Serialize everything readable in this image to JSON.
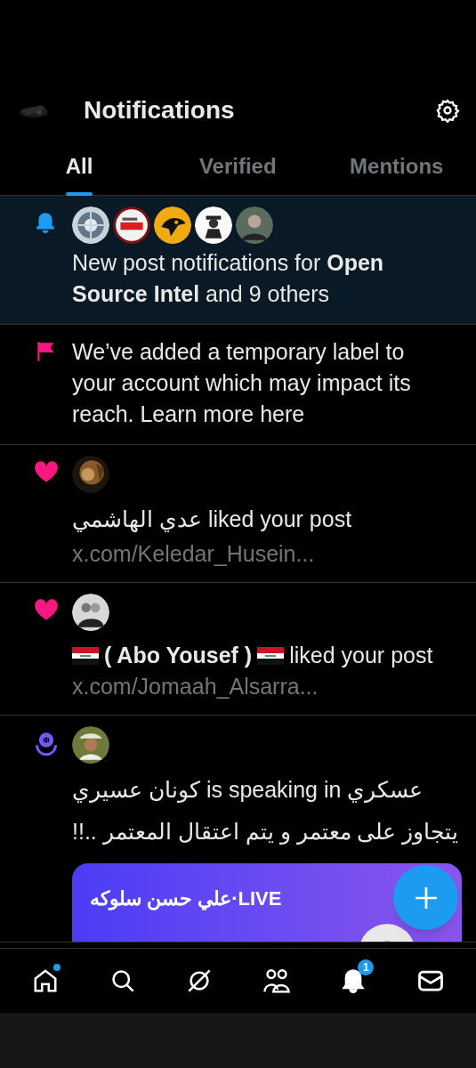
{
  "header": {
    "title": "Notifications"
  },
  "tabs": [
    {
      "label": "All",
      "selected": true
    },
    {
      "label": "Verified",
      "selected": false
    },
    {
      "label": "Mentions",
      "selected": false
    }
  ],
  "notifications": [
    {
      "kind": "subscription",
      "highlighted": true,
      "avatars": [
        {
          "kind": "picture"
        },
        {
          "kind": "picture"
        },
        {
          "kind": "picture"
        },
        {
          "kind": "picture"
        },
        {
          "kind": "picture"
        }
      ],
      "text": "New post notifications for **Open Source Intel** and 9 others"
    },
    {
      "kind": "label",
      "highlighted": false,
      "text": "We’ve added a temporary label to your account which may impact its reach. Learn more here"
    },
    {
      "kind": "like",
      "highlighted": false,
      "avatars": [
        {
          "kind": "picture"
        }
      ],
      "text": "عدي الهاشمي liked your post",
      "link": "x.com/Keledar_Husein..."
    },
    {
      "kind": "like",
      "highlighted": false,
      "avatars": [
        {
          "kind": "picture"
        }
      ],
      "parts": [
        {
          "kind": "flag"
        },
        {
          "kind": "name",
          "text": "( Abo Yousef )"
        },
        {
          "kind": "flag"
        },
        {
          "kind": "text",
          "text": "liked your post"
        }
      ],
      "link": "x.com/Jomaah_Alsarra..."
    },
    {
      "kind": "space",
      "highlighted": false,
      "avatars": [
        {
          "kind": "picture"
        }
      ],
      "text": "كونان عسيري is speaking in عسكري",
      "title": "يتجاوز على معتمر و يتم اعتقال المعتمر ..!!",
      "card": {
        "label": "**LIVE**·علي حسن سلوكه"
      }
    }
  ],
  "nav": [
    {
      "kind": "home",
      "dot": true,
      "selected": false
    },
    {
      "kind": "search",
      "selected": false
    },
    {
      "kind": "grok",
      "selected": false
    },
    {
      "kind": "communities",
      "selected": false
    },
    {
      "kind": "notifications",
      "badge": "1",
      "selected": true
    },
    {
      "kind": "messages",
      "selected": false
    }
  ]
}
